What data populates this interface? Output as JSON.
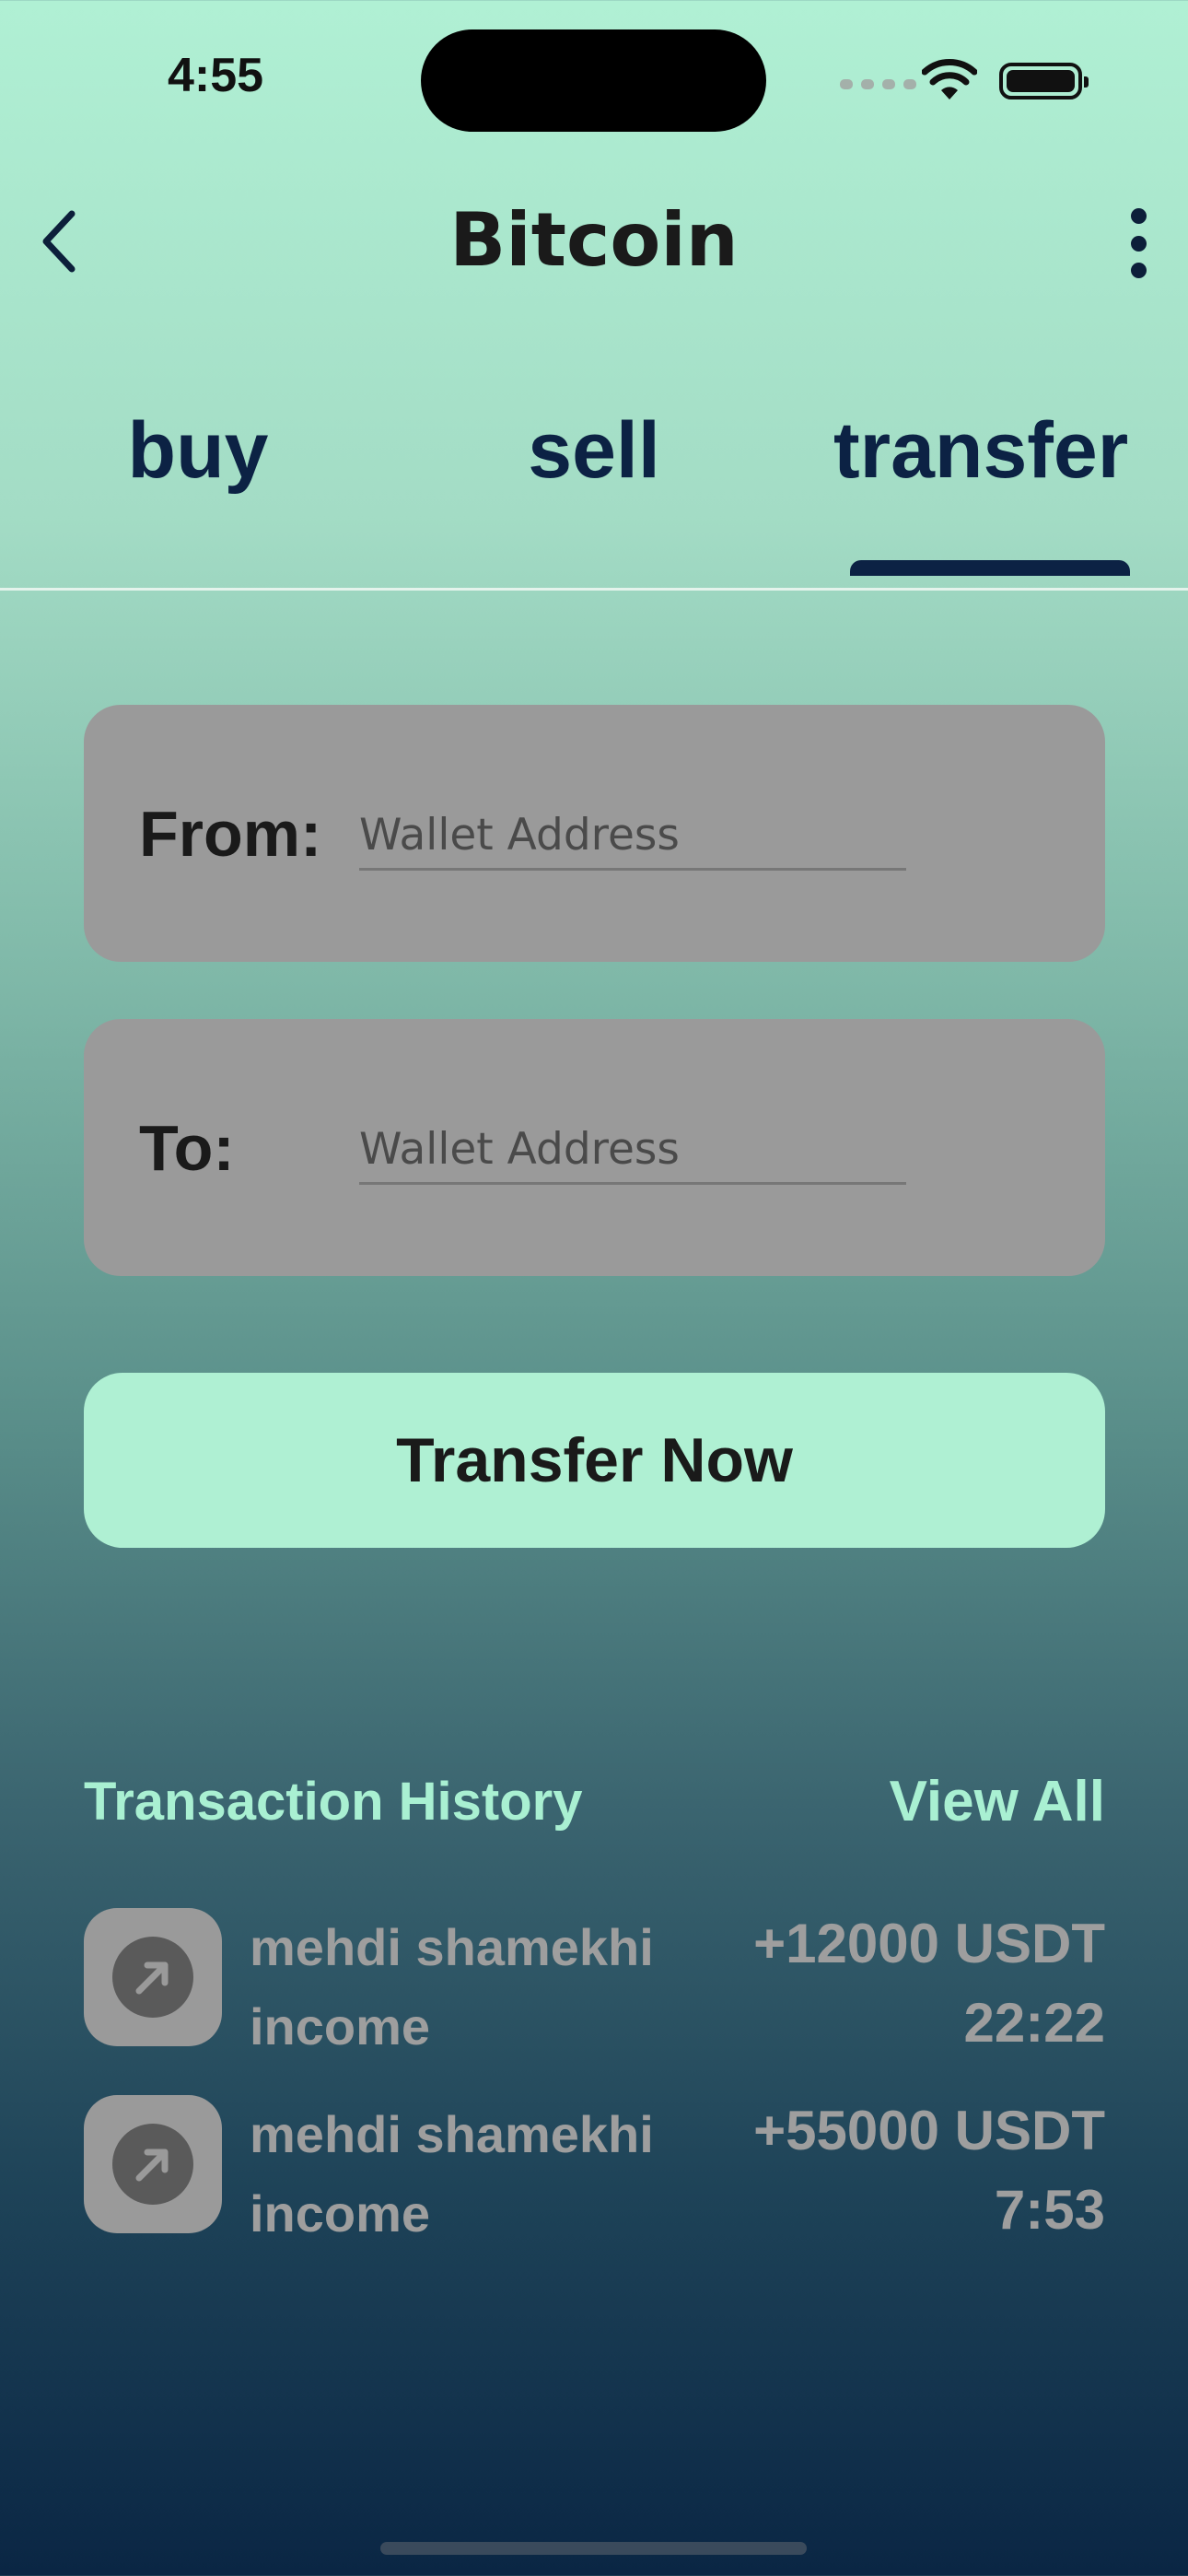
{
  "status_bar": {
    "time": "4:55"
  },
  "header": {
    "title": "Bitcoin"
  },
  "tabs": [
    {
      "label": "buy"
    },
    {
      "label": "sell"
    },
    {
      "label": "transfer",
      "active": true
    }
  ],
  "form": {
    "from_label": "From:",
    "from_placeholder": "Wallet Address",
    "to_label": "To:",
    "to_placeholder": "Wallet Address",
    "submit_label": "Transfer Now"
  },
  "history": {
    "title": "Transaction History",
    "view_all": "View All",
    "items": [
      {
        "name": "mehdi shamekhi",
        "type": "income",
        "amount": "+12000 USDT",
        "time": "22:22"
      },
      {
        "name": "mehdi shamekhi",
        "type": "income",
        "amount": "+55000 USDT",
        "time": "7:53"
      }
    ]
  },
  "colors": {
    "accent": "#aff0d3",
    "dark_navy": "#0c2244",
    "card_gray": "#9a9a9a"
  },
  "icons": [
    "back-chevron-icon",
    "more-vertical-icon",
    "arrow-up-right-icon",
    "wifi-icon",
    "battery-icon",
    "signal-icon"
  ]
}
